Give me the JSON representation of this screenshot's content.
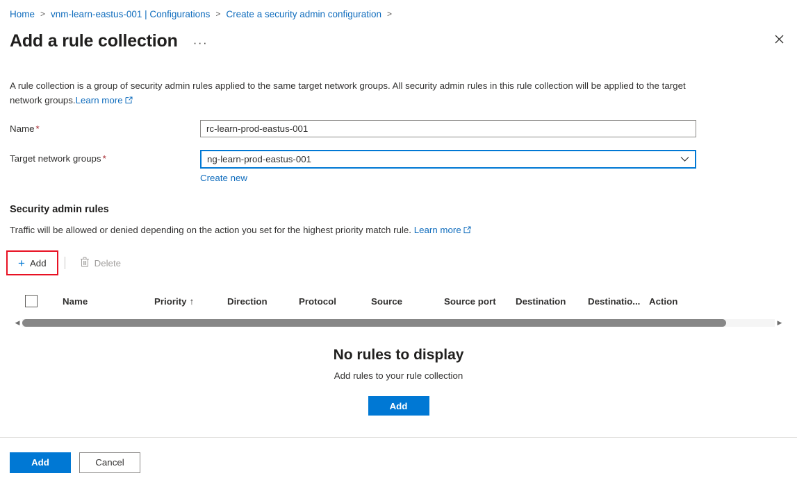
{
  "breadcrumb": {
    "items": [
      {
        "label": "Home"
      },
      {
        "label": "vnm-learn-eastus-001 | Configurations"
      },
      {
        "label": "Create a security admin configuration"
      }
    ],
    "separator": ">"
  },
  "header": {
    "title": "Add a rule collection",
    "ellipsis": "···",
    "close_icon": "close-icon"
  },
  "description": {
    "text": "A rule collection is a group of security admin rules applied to the same target network groups. All security admin rules in this rule collection will be applied to the target network groups.",
    "learn_more": "Learn more"
  },
  "form": {
    "name": {
      "label": "Name",
      "required": "*",
      "value": "rc-learn-prod-eastus-001",
      "placeholder": ""
    },
    "target_network_groups": {
      "label": "Target network groups",
      "required": "*",
      "value": "ng-learn-prod-eastus-001",
      "create_new": "Create new"
    }
  },
  "rules_section": {
    "heading": "Security admin rules",
    "subtext": "Traffic will be allowed or denied depending on the action you set for the highest priority match rule.",
    "learn_more": "Learn more",
    "commands": {
      "add": "Add",
      "delete": "Delete"
    },
    "table": {
      "columns": [
        "Name",
        "Priority",
        "Direction",
        "Protocol",
        "Source",
        "Source port",
        "Destination",
        "Destinatio...",
        "Action"
      ],
      "sort_indicator": "↑",
      "rows": []
    },
    "empty_state": {
      "title": "No rules to display",
      "subtitle": "Add rules to your rule collection",
      "button": "Add"
    }
  },
  "footer": {
    "add": "Add",
    "cancel": "Cancel"
  },
  "colors": {
    "accent": "#0078d4",
    "link": "#0f6cbd",
    "required": "#a4262c",
    "highlight": "#e81123"
  }
}
